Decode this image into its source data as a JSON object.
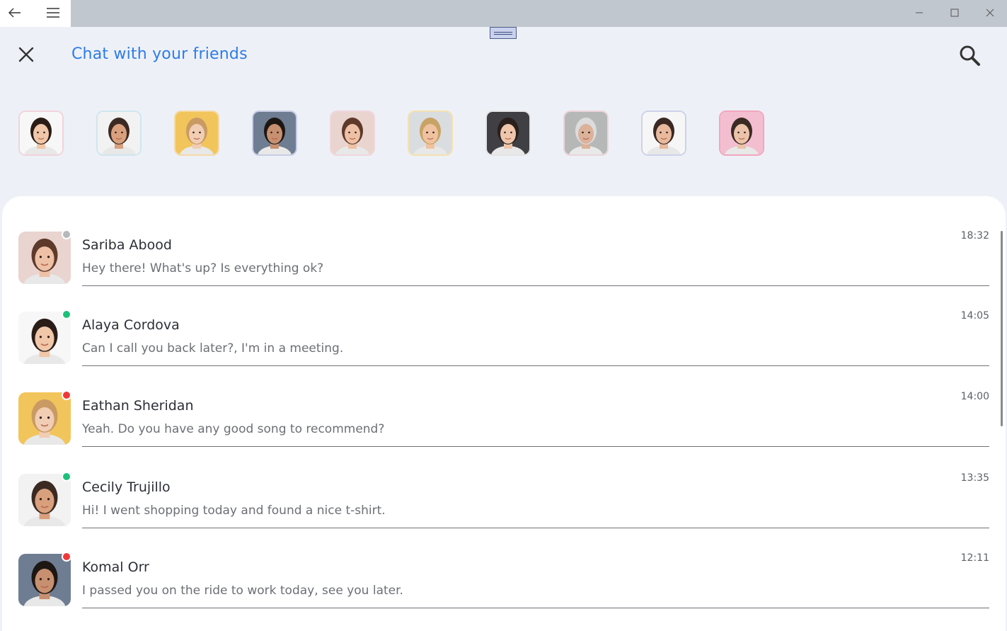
{
  "titlebar": {
    "back_icon": "arrow-left-icon",
    "menu_icon": "hamburger-icon",
    "controls": [
      "minimize-icon",
      "maximize-icon",
      "close-icon"
    ]
  },
  "header": {
    "title": "Chat with your friends",
    "close_icon": "close-icon",
    "search_icon": "search-icon"
  },
  "colors": {
    "accent": "#2e7be8",
    "online": "#1dc07a",
    "busy": "#f03838",
    "offline": "#b6b8bc",
    "background": "#edf1f7"
  },
  "friends": [
    {
      "bg": "#f7f7f7",
      "skin": "#f0c7a8",
      "hair": "#2a1c17",
      "border": "#f2d3db"
    },
    {
      "bg": "#f2f2f2",
      "skin": "#d9a07e",
      "hair": "#3b2a22",
      "border": "#cfe6ef"
    },
    {
      "bg": "#f2c55c",
      "skin": "#f1cdb4",
      "hair": "#c99b63",
      "border": "#f5d9a6"
    },
    {
      "bg": "#6f7d93",
      "skin": "#c79070",
      "hair": "#1d1714",
      "border": "#c7cde4"
    },
    {
      "bg": "#e9d4d0",
      "skin": "#eec1a6",
      "hair": "#5e3a2a",
      "border": "#f0d6dc"
    },
    {
      "bg": "#d9dde0",
      "skin": "#efc2a0",
      "hair": "#c8a366",
      "border": "#f5e0b0"
    },
    {
      "bg": "#3f3f44",
      "skin": "#efc6ac",
      "hair": "#2a1f1c",
      "border": "#e4e4e6"
    },
    {
      "bg": "#b6b8b8",
      "skin": "#dcb19a",
      "hair": "#dcdcdc",
      "border": "#ecd4da"
    },
    {
      "bg": "#f6f6f6",
      "skin": "#e8b99d",
      "hair": "#3a2823",
      "border": "#cdd2ea"
    },
    {
      "bg": "#f3bfd0",
      "skin": "#ecc3aa",
      "hair": "#3a2a23",
      "border": "#f2a6bf"
    }
  ],
  "chats": [
    {
      "name": "Sariba Abood",
      "message": "Hey there! What's up? Is everything ok?",
      "time": "18:32",
      "status": "offline",
      "status_color": "#b6b8bc",
      "avatar": {
        "bg": "#e9d4d0",
        "skin": "#eec1a6",
        "hair": "#5e3a2a"
      }
    },
    {
      "name": "Alaya Cordova",
      "message": "Can I call you back later?, I'm in a meeting.",
      "time": "14:05",
      "status": "online",
      "status_color": "#1dc07a",
      "avatar": {
        "bg": "#f7f7f7",
        "skin": "#f0c7a8",
        "hair": "#2a1c17"
      }
    },
    {
      "name": "Eathan Sheridan",
      "message": "Yeah. Do you have any good song to recommend?",
      "time": "14:00",
      "status": "busy",
      "status_color": "#f03838",
      "avatar": {
        "bg": "#f2c55c",
        "skin": "#f1cdb4",
        "hair": "#c99b63"
      }
    },
    {
      "name": "Cecily Trujillo",
      "message": "Hi! I went shopping today and found a nice t-shirt.",
      "time": "13:35",
      "status": "online",
      "status_color": "#1dc07a",
      "avatar": {
        "bg": "#f2f2f2",
        "skin": "#d9a07e",
        "hair": "#3b2a22"
      }
    },
    {
      "name": "Komal Orr",
      "message": "I passed you on the ride to work today, see you later.",
      "time": "12:11",
      "status": "busy",
      "status_color": "#f03838",
      "avatar": {
        "bg": "#6f7d93",
        "skin": "#c79070",
        "hair": "#1d1714"
      }
    }
  ]
}
